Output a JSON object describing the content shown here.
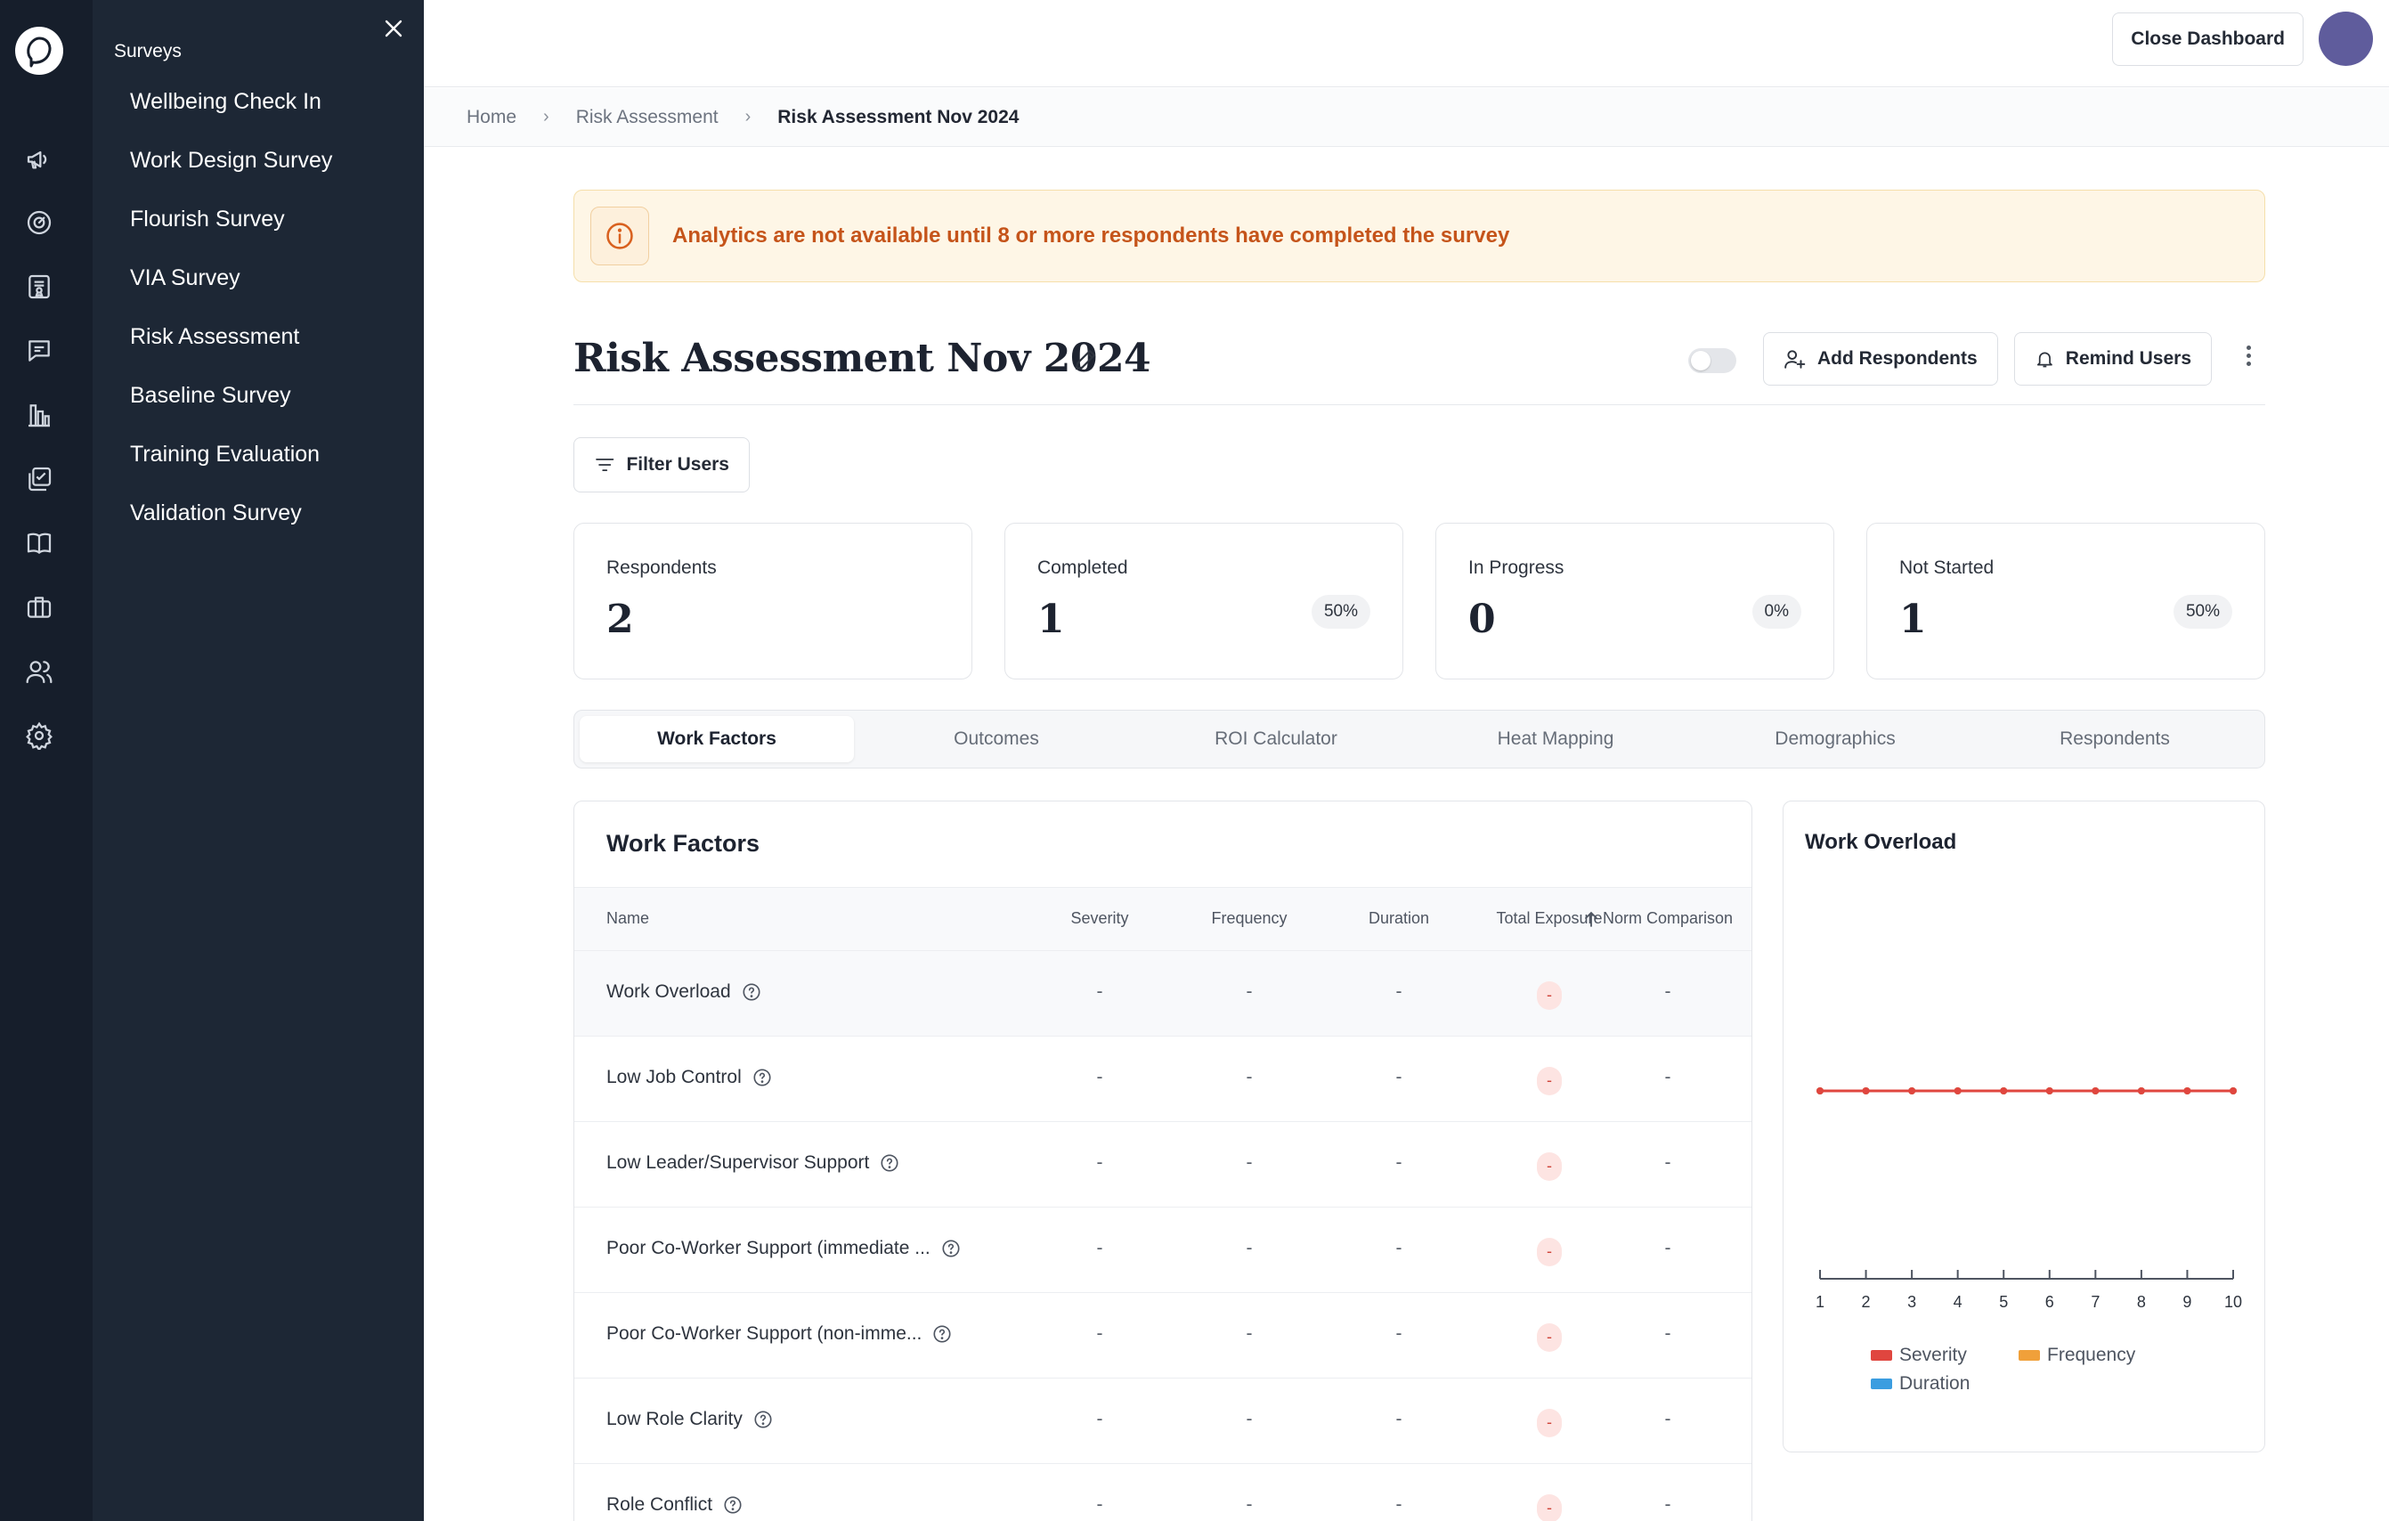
{
  "sidebar_rail": {
    "items": [
      "logo-icon",
      "megaphone-icon",
      "gauge-icon",
      "certificate-icon",
      "chat-icon",
      "bar-chart-icon",
      "checklist-icon",
      "book-icon",
      "briefcase-icon",
      "users-icon",
      "gear-icon"
    ]
  },
  "surveys_panel": {
    "title": "Surveys",
    "items": [
      {
        "label": "Wellbeing Check In"
      },
      {
        "label": "Work Design Survey"
      },
      {
        "label": "Flourish Survey"
      },
      {
        "label": "VIA Survey"
      },
      {
        "label": "Risk Assessment"
      },
      {
        "label": "Baseline Survey"
      },
      {
        "label": "Training Evaluation"
      },
      {
        "label": "Validation Survey"
      }
    ]
  },
  "topbar": {
    "close_dashboard_label": "Close Dashboard"
  },
  "breadcrumb": {
    "home": "Home",
    "section": "Risk Assessment",
    "current": "Risk Assessment Nov 2024"
  },
  "banner": {
    "text": "Analytics are not available until 8 or more respondents have completed the survey"
  },
  "page": {
    "title": "Risk Assessment Nov 2024",
    "add_respondents_label": "Add Respondents",
    "remind_users_label": "Remind Users",
    "filter_users_label": "Filter Users",
    "toggle_on": false
  },
  "stats": [
    {
      "label": "Respondents",
      "value": "2",
      "percent": ""
    },
    {
      "label": "Completed",
      "value": "1",
      "percent": "50%"
    },
    {
      "label": "In Progress",
      "value": "0",
      "percent": "0%"
    },
    {
      "label": "Not Started",
      "value": "1",
      "percent": "50%"
    }
  ],
  "tabs": [
    {
      "label": "Work Factors",
      "active": true
    },
    {
      "label": "Outcomes"
    },
    {
      "label": "ROI Calculator"
    },
    {
      "label": "Heat Mapping"
    },
    {
      "label": "Demographics"
    },
    {
      "label": "Respondents"
    }
  ],
  "work_factors": {
    "title": "Work Factors",
    "columns": {
      "name": "Name",
      "severity": "Severity",
      "frequency": "Frequency",
      "duration": "Duration",
      "total_exposure": "Total Exposure",
      "norm_comparison": "Norm Comparison"
    },
    "rows": [
      {
        "name": "Work Overload",
        "severity": "-",
        "frequency": "-",
        "duration": "-",
        "total": "-",
        "norm": "-"
      },
      {
        "name": "Low Job Control",
        "severity": "-",
        "frequency": "-",
        "duration": "-",
        "total": "-",
        "norm": "-"
      },
      {
        "name": "Low Leader/Supervisor Support",
        "severity": "-",
        "frequency": "-",
        "duration": "-",
        "total": "-",
        "norm": "-"
      },
      {
        "name": "Poor Co-Worker Support (immediate ...",
        "severity": "-",
        "frequency": "-",
        "duration": "-",
        "total": "-",
        "norm": "-"
      },
      {
        "name": "Poor Co-Worker Support (non-imme...",
        "severity": "-",
        "frequency": "-",
        "duration": "-",
        "total": "-",
        "norm": "-"
      },
      {
        "name": "Low Role Clarity",
        "severity": "-",
        "frequency": "-",
        "duration": "-",
        "total": "-",
        "norm": "-"
      },
      {
        "name": "Role Conflict",
        "severity": "-",
        "frequency": "-",
        "duration": "-",
        "total": "-",
        "norm": "-"
      }
    ]
  },
  "chart_data": {
    "type": "line",
    "title": "Work Overload",
    "x": [
      1,
      2,
      3,
      4,
      5,
      6,
      7,
      8,
      9,
      10
    ],
    "series": [
      {
        "name": "Severity",
        "color": "#e0463f",
        "values": [
          0,
          0,
          0,
          0,
          0,
          0,
          0,
          0,
          0,
          0
        ]
      },
      {
        "name": "Frequency",
        "color": "#f0a03a",
        "values": [
          0,
          0,
          0,
          0,
          0,
          0,
          0,
          0,
          0,
          0
        ]
      },
      {
        "name": "Duration",
        "color": "#3b9de0",
        "values": [
          0,
          0,
          0,
          0,
          0,
          0,
          0,
          0,
          0,
          0
        ]
      }
    ],
    "legend": "bottom",
    "grid": false
  },
  "colors": {
    "rail_bg": "#161e2b",
    "panel_bg": "#1d2735",
    "banner_bg": "#fef6e6",
    "banner_text": "#c5541a",
    "avatar": "#5f5c9c"
  }
}
